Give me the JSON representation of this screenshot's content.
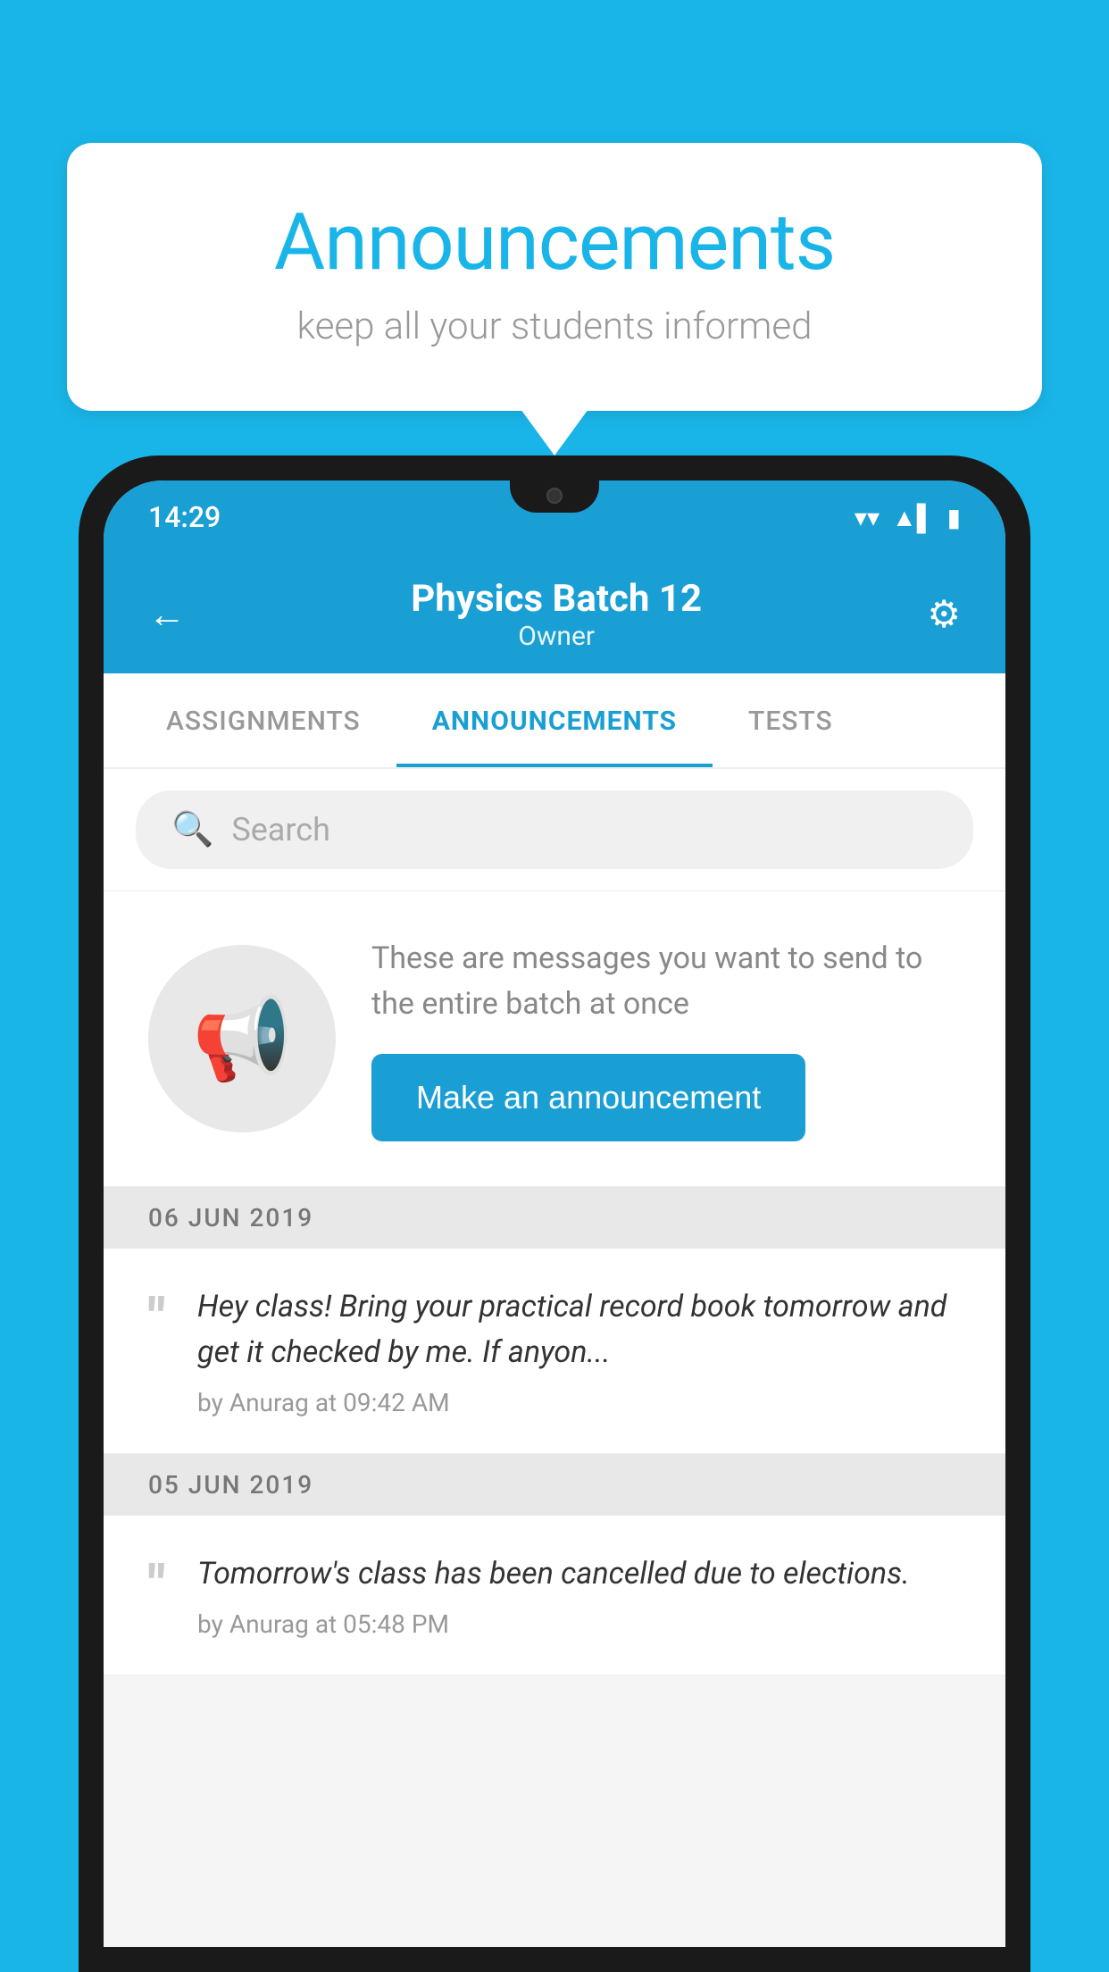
{
  "page": {
    "background_color": "#1ab5e8"
  },
  "speech_bubble": {
    "title": "Announcements",
    "subtitle": "keep all your students informed"
  },
  "phone": {
    "status_bar": {
      "time": "14:29",
      "wifi": "▼",
      "signal": "◀",
      "battery": "▮"
    },
    "header": {
      "back_label": "←",
      "title": "Physics Batch 12",
      "subtitle": "Owner",
      "gear_label": "⚙"
    },
    "tabs": [
      {
        "label": "ASSIGNMENTS",
        "active": false
      },
      {
        "label": "ANNOUNCEMENTS",
        "active": true
      },
      {
        "label": "TESTS",
        "active": false
      }
    ],
    "search": {
      "placeholder": "Search"
    },
    "announcement_intro": {
      "description": "These are messages you want to send to the entire batch at once",
      "button_label": "Make an announcement"
    },
    "messages": [
      {
        "date": "06  JUN  2019",
        "text": "Hey class! Bring your practical record book tomorrow and get it checked by me. If anyon...",
        "meta": "by Anurag at 09:42 AM"
      },
      {
        "date": "05  JUN  2019",
        "text": "Tomorrow's class has been cancelled due to elections.",
        "meta": "by Anurag at 05:48 PM"
      }
    ]
  }
}
